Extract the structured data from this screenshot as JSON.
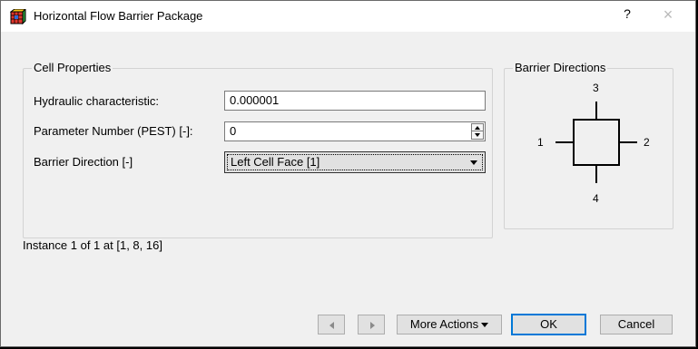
{
  "window": {
    "title": "Horizontal Flow Barrier Package",
    "help": "?",
    "close": "×"
  },
  "cell_properties": {
    "title": "Cell Properties",
    "hydraulic": {
      "label": "Hydraulic characteristic:",
      "value": "0.000001"
    },
    "parameter": {
      "label": "Parameter Number (PEST) [-]:",
      "value": "0"
    },
    "direction": {
      "label": "Barrier Direction [-]",
      "value": "Left Cell Face [1]"
    }
  },
  "barrier_directions": {
    "title": "Barrier Directions",
    "labels": {
      "top": "3",
      "left": "1",
      "right": "2",
      "bottom": "4"
    }
  },
  "status": "Instance 1 of 1 at [1, 8, 16]",
  "buttons": {
    "more_actions": "More Actions",
    "ok": "OK",
    "cancel": "Cancel"
  },
  "colors": {
    "accent": "#0078d7",
    "background": "#f0f0f0"
  }
}
